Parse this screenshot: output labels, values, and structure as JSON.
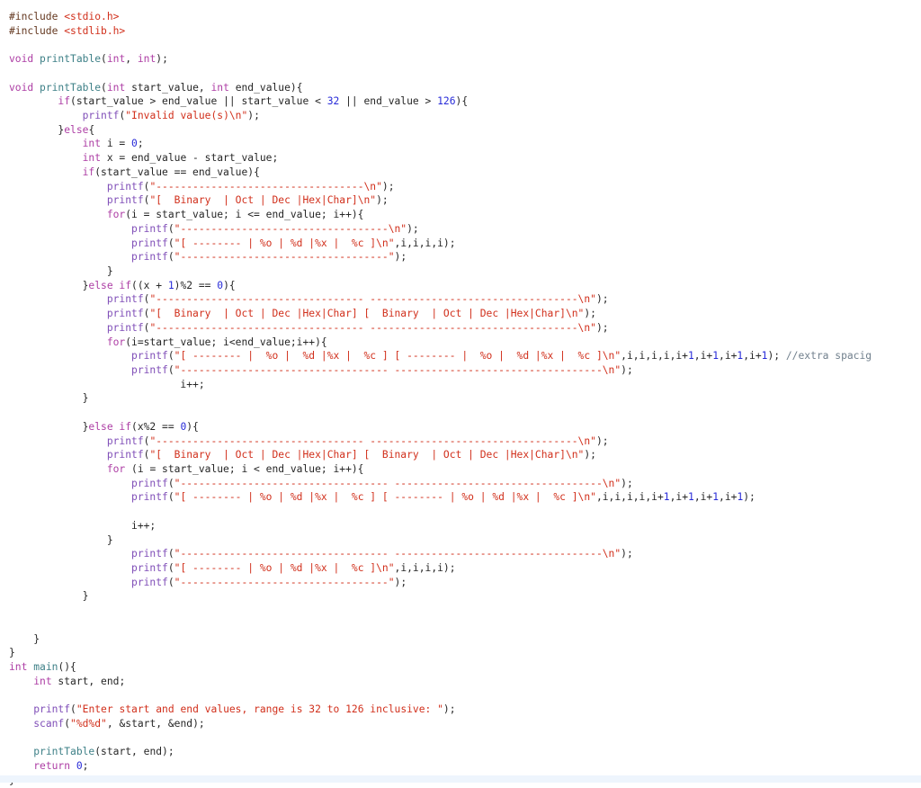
{
  "colors": {
    "text": "#262626",
    "preprocessor": "#643820",
    "string": "#d12f1b",
    "keyword": "#ad3da4",
    "function": "#3e8087",
    "library_function": "#804fb8",
    "number": "#272ad8",
    "comment": "#707f8c",
    "bottom_band": "#eef5fd"
  },
  "code_lines": [
    [
      [
        "p",
        "#include "
      ],
      [
        "s",
        "<stdio.h>"
      ]
    ],
    [
      [
        "p",
        "#include "
      ],
      [
        "s",
        "<stdlib.h>"
      ]
    ],
    [],
    [
      [
        "k",
        "void"
      ],
      [
        "t",
        " "
      ],
      [
        "f",
        "printTable"
      ],
      [
        "t",
        "("
      ],
      [
        "k",
        "int"
      ],
      [
        "t",
        ", "
      ],
      [
        "k",
        "int"
      ],
      [
        "t",
        ");"
      ]
    ],
    [],
    [
      [
        "k",
        "void"
      ],
      [
        "t",
        " "
      ],
      [
        "f",
        "printTable"
      ],
      [
        "t",
        "("
      ],
      [
        "k",
        "int"
      ],
      [
        "t",
        " start_value, "
      ],
      [
        "k",
        "int"
      ],
      [
        "t",
        " end_value){"
      ]
    ],
    [
      [
        "t",
        "        "
      ],
      [
        "k",
        "if"
      ],
      [
        "t",
        "(start_value > end_value || start_value < "
      ],
      [
        "n",
        "32"
      ],
      [
        "t",
        " || end_value > "
      ],
      [
        "n",
        "126"
      ],
      [
        "t",
        "){"
      ]
    ],
    [
      [
        "t",
        "            "
      ],
      [
        "pf",
        "printf"
      ],
      [
        "t",
        "("
      ],
      [
        "s",
        "\"Invalid value(s)\\n\""
      ],
      [
        "t",
        ");"
      ]
    ],
    [
      [
        "t",
        "        }"
      ],
      [
        "k",
        "else"
      ],
      [
        "t",
        "{"
      ]
    ],
    [
      [
        "t",
        "            "
      ],
      [
        "k",
        "int"
      ],
      [
        "t",
        " i = "
      ],
      [
        "n",
        "0"
      ],
      [
        "t",
        ";"
      ]
    ],
    [
      [
        "t",
        "            "
      ],
      [
        "k",
        "int"
      ],
      [
        "t",
        " x = end_value - start_value;"
      ]
    ],
    [
      [
        "t",
        "            "
      ],
      [
        "k",
        "if"
      ],
      [
        "t",
        "(start_value == end_value){"
      ]
    ],
    [
      [
        "t",
        "                "
      ],
      [
        "pf",
        "printf"
      ],
      [
        "t",
        "("
      ],
      [
        "s",
        "\"----------------------------------\\n\""
      ],
      [
        "t",
        ");"
      ]
    ],
    [
      [
        "t",
        "                "
      ],
      [
        "pf",
        "printf"
      ],
      [
        "t",
        "("
      ],
      [
        "s",
        "\"[  Binary  | Oct | Dec |Hex|Char]\\n\""
      ],
      [
        "t",
        ");"
      ]
    ],
    [
      [
        "t",
        "                "
      ],
      [
        "k",
        "for"
      ],
      [
        "t",
        "(i = start_value; i <= end_value; i++){"
      ]
    ],
    [
      [
        "t",
        "                    "
      ],
      [
        "pf",
        "printf"
      ],
      [
        "t",
        "("
      ],
      [
        "s",
        "\"----------------------------------\\n\""
      ],
      [
        "t",
        ");"
      ]
    ],
    [
      [
        "t",
        "                    "
      ],
      [
        "pf",
        "printf"
      ],
      [
        "t",
        "("
      ],
      [
        "s",
        "\"[ -------- | %o | %d |%x |  %c ]\\n\""
      ],
      [
        "t",
        ",i,i,i,i);"
      ]
    ],
    [
      [
        "t",
        "                    "
      ],
      [
        "pf",
        "printf"
      ],
      [
        "t",
        "("
      ],
      [
        "s",
        "\"----------------------------------\""
      ],
      [
        "t",
        ");"
      ]
    ],
    [
      [
        "t",
        "                }"
      ]
    ],
    [
      [
        "t",
        "            }"
      ],
      [
        "k",
        "else if"
      ],
      [
        "t",
        "((x + "
      ],
      [
        "n",
        "1"
      ],
      [
        "t",
        ")%2 == "
      ],
      [
        "n",
        "0"
      ],
      [
        "t",
        "){"
      ]
    ],
    [
      [
        "t",
        "                "
      ],
      [
        "pf",
        "printf"
      ],
      [
        "t",
        "("
      ],
      [
        "s",
        "\"---------------------------------- ----------------------------------\\n\""
      ],
      [
        "t",
        ");"
      ]
    ],
    [
      [
        "t",
        "                "
      ],
      [
        "pf",
        "printf"
      ],
      [
        "t",
        "("
      ],
      [
        "s",
        "\"[  Binary  | Oct | Dec |Hex|Char] [  Binary  | Oct | Dec |Hex|Char]\\n\""
      ],
      [
        "t",
        ");"
      ]
    ],
    [
      [
        "t",
        "                "
      ],
      [
        "pf",
        "printf"
      ],
      [
        "t",
        "("
      ],
      [
        "s",
        "\"---------------------------------- ----------------------------------\\n\""
      ],
      [
        "t",
        ");"
      ]
    ],
    [
      [
        "t",
        "                "
      ],
      [
        "k",
        "for"
      ],
      [
        "t",
        "(i=start_value; i<end_value;i++){"
      ]
    ],
    [
      [
        "t",
        "                    "
      ],
      [
        "pf",
        "printf"
      ],
      [
        "t",
        "("
      ],
      [
        "s",
        "\"[ -------- |  %o |  %d |%x |  %c ] [ -------- |  %o |  %d |%x |  %c ]\\n\""
      ],
      [
        "t",
        ",i,i,i,i,i+"
      ],
      [
        "n",
        "1"
      ],
      [
        "t",
        ",i+"
      ],
      [
        "n",
        "1"
      ],
      [
        "t",
        ",i+"
      ],
      [
        "n",
        "1"
      ],
      [
        "t",
        ",i+"
      ],
      [
        "n",
        "1"
      ],
      [
        "t",
        "); "
      ],
      [
        "c",
        "//extra spacig"
      ]
    ],
    [
      [
        "t",
        "                    "
      ],
      [
        "pf",
        "printf"
      ],
      [
        "t",
        "("
      ],
      [
        "s",
        "\"---------------------------------- ----------------------------------\\n\""
      ],
      [
        "t",
        ");"
      ]
    ],
    [
      [
        "t",
        "                            i++;"
      ]
    ],
    [
      [
        "t",
        "            }"
      ]
    ],
    [],
    [
      [
        "t",
        "            }"
      ],
      [
        "k",
        "else if"
      ],
      [
        "t",
        "(x%2 == "
      ],
      [
        "n",
        "0"
      ],
      [
        "t",
        "){"
      ]
    ],
    [
      [
        "t",
        "                "
      ],
      [
        "pf",
        "printf"
      ],
      [
        "t",
        "("
      ],
      [
        "s",
        "\"---------------------------------- ----------------------------------\\n\""
      ],
      [
        "t",
        ");"
      ]
    ],
    [
      [
        "t",
        "                "
      ],
      [
        "pf",
        "printf"
      ],
      [
        "t",
        "("
      ],
      [
        "s",
        "\"[  Binary  | Oct | Dec |Hex|Char] [  Binary  | Oct | Dec |Hex|Char]\\n\""
      ],
      [
        "t",
        ");"
      ]
    ],
    [
      [
        "t",
        "                "
      ],
      [
        "k",
        "for"
      ],
      [
        "t",
        " (i = start_value; i < end_value; i++){"
      ]
    ],
    [
      [
        "t",
        "                    "
      ],
      [
        "pf",
        "printf"
      ],
      [
        "t",
        "("
      ],
      [
        "s",
        "\"---------------------------------- ----------------------------------\\n\""
      ],
      [
        "t",
        ");"
      ]
    ],
    [
      [
        "t",
        "                    "
      ],
      [
        "pf",
        "printf"
      ],
      [
        "t",
        "("
      ],
      [
        "s",
        "\"[ -------- | %o | %d |%x |  %c ] [ -------- | %o | %d |%x |  %c ]\\n\""
      ],
      [
        "t",
        ",i,i,i,i,i+"
      ],
      [
        "n",
        "1"
      ],
      [
        "t",
        ",i+"
      ],
      [
        "n",
        "1"
      ],
      [
        "t",
        ",i+"
      ],
      [
        "n",
        "1"
      ],
      [
        "t",
        ",i+"
      ],
      [
        "n",
        "1"
      ],
      [
        "t",
        ");"
      ]
    ],
    [],
    [
      [
        "t",
        "                    i++;"
      ]
    ],
    [
      [
        "t",
        "                }"
      ]
    ],
    [
      [
        "t",
        "                    "
      ],
      [
        "pf",
        "printf"
      ],
      [
        "t",
        "("
      ],
      [
        "s",
        "\"---------------------------------- ----------------------------------\\n\""
      ],
      [
        "t",
        ");"
      ]
    ],
    [
      [
        "t",
        "                    "
      ],
      [
        "pf",
        "printf"
      ],
      [
        "t",
        "("
      ],
      [
        "s",
        "\"[ -------- | %o | %d |%x |  %c ]\\n\""
      ],
      [
        "t",
        ",i,i,i,i);"
      ]
    ],
    [
      [
        "t",
        "                    "
      ],
      [
        "pf",
        "printf"
      ],
      [
        "t",
        "("
      ],
      [
        "s",
        "\"----------------------------------\""
      ],
      [
        "t",
        ");"
      ]
    ],
    [
      [
        "t",
        "            }"
      ]
    ],
    [],
    [],
    [
      [
        "t",
        "    }"
      ]
    ],
    [
      [
        "t",
        "}"
      ]
    ],
    [
      [
        "k",
        "int"
      ],
      [
        "t",
        " "
      ],
      [
        "f",
        "main"
      ],
      [
        "t",
        "(){"
      ]
    ],
    [
      [
        "t",
        "    "
      ],
      [
        "k",
        "int"
      ],
      [
        "t",
        " start, end;"
      ]
    ],
    [],
    [
      [
        "t",
        "    "
      ],
      [
        "pf",
        "printf"
      ],
      [
        "t",
        "("
      ],
      [
        "s",
        "\"Enter start and end values, range is 32 to 126 inclusive: \""
      ],
      [
        "t",
        ");"
      ]
    ],
    [
      [
        "t",
        "    "
      ],
      [
        "pf",
        "scanf"
      ],
      [
        "t",
        "("
      ],
      [
        "s",
        "\"%d%d\""
      ],
      [
        "t",
        ", &start, &end);"
      ]
    ],
    [],
    [
      [
        "t",
        "    "
      ],
      [
        "f",
        "printTable"
      ],
      [
        "t",
        "(start, end);"
      ]
    ],
    [
      [
        "t",
        "    "
      ],
      [
        "k",
        "return"
      ],
      [
        "t",
        " "
      ],
      [
        "n",
        "0"
      ],
      [
        "t",
        ";"
      ]
    ],
    [
      [
        "t",
        "}"
      ]
    ]
  ]
}
